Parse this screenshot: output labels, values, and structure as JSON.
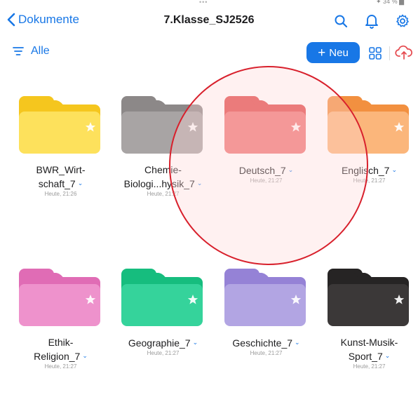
{
  "status_bar": {
    "dots": "•••",
    "right_text": "✦ 34 % ▆"
  },
  "nav": {
    "back_label": "Dokumente",
    "title": "7.Klasse_SJ2526"
  },
  "toolbar": {
    "filter_label": "Alle",
    "new_label": "Neu"
  },
  "colors": {
    "accent": "#1877e6",
    "annotation": "#d8202c"
  },
  "folders": [
    {
      "name_lines": [
        "BWR_Wirt-",
        "schaft_7"
      ],
      "date": "Heute, 21:26",
      "color": "#fde15c",
      "color_dark": "#f5c61e",
      "star": "white"
    },
    {
      "name_lines": [
        "Chemie-",
        "Biologi...hysik_7"
      ],
      "date": "Heute, 21:27",
      "color": "#a8a4a4",
      "color_dark": "#8c8888",
      "star": "white"
    },
    {
      "name_lines": [
        "Deutsch_7"
      ],
      "date": "Heute, 21:27",
      "color": "#ef7777",
      "color_dark": "#e04a4a",
      "star": "white"
    },
    {
      "name_lines": [
        "Englisch_7"
      ],
      "date": "Heute, 21:27",
      "color": "#fbb67b",
      "color_dark": "#f29040",
      "star": "white"
    },
    {
      "name_lines": [
        "Ethik-",
        "Religion_7"
      ],
      "date": "Heute, 21:27",
      "color": "#ee92cc",
      "color_dark": "#e06cb5",
      "star": "white"
    },
    {
      "name_lines": [
        "Geographie_7"
      ],
      "date": "Heute, 21:27",
      "color": "#35d39b",
      "color_dark": "#16bd7e",
      "star": "white"
    },
    {
      "name_lines": [
        "Geschichte_7"
      ],
      "date": "Heute, 21:27",
      "color": "#b2a5e3",
      "color_dark": "#9582d6",
      "star": "white"
    },
    {
      "name_lines": [
        "Kunst-Musik-",
        "Sport_7"
      ],
      "date": "Heute, 21:27",
      "color": "#3b3838",
      "color_dark": "#262424",
      "star": "white"
    }
  ]
}
